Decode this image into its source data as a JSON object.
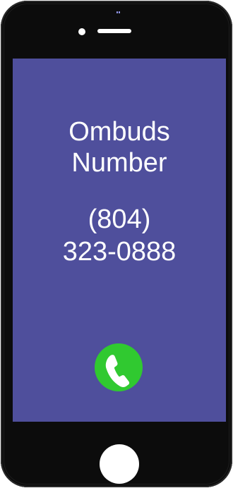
{
  "device": {
    "body_color": "#0c0c0c",
    "screen_color": "#4f4f9c",
    "text_color": "#ffffff"
  },
  "contact": {
    "name_line1": "Ombuds",
    "name_line2": "Number",
    "phone_line1": "(804)",
    "phone_line2": "323-0888"
  },
  "call_button": {
    "icon": "phone-handset-icon",
    "color": "#30c930"
  },
  "home_button": {
    "icon": "home-button",
    "color": "#ffffff"
  }
}
